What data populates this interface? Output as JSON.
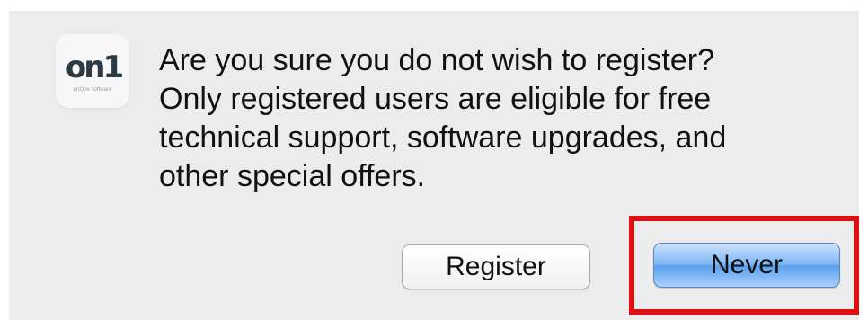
{
  "dialog": {
    "app_icon": {
      "logo_text": "on1",
      "sub_text": "onOne software"
    },
    "message_lines": [
      "Are you sure you do not wish to register?",
      "Only registered users are eligible for free",
      "technical support, software upgrades, and",
      "other special offers."
    ],
    "buttons": {
      "register_label": "Register",
      "never_label": "Never"
    },
    "highlight_color": "#e01010",
    "default_button_color": "#5aa0ef"
  }
}
